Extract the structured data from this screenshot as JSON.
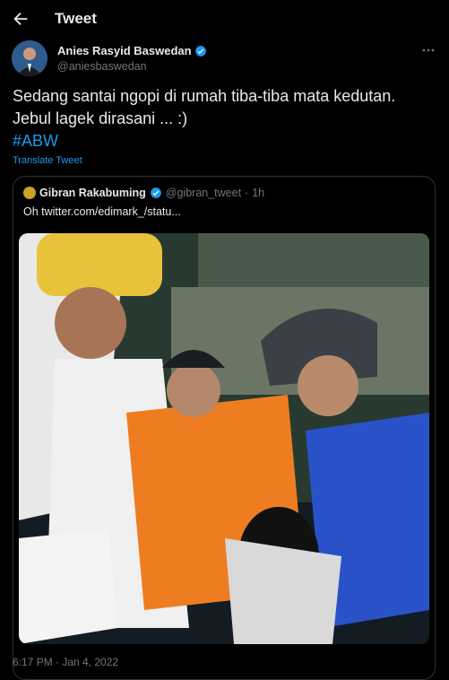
{
  "header": {
    "title": "Tweet"
  },
  "author": {
    "name": "Anies Rasyid Baswedan",
    "handle": "@aniesbaswedan"
  },
  "tweet": {
    "line1": "Sedang santai ngopi di rumah tiba-tiba mata kedutan.",
    "line2": "Jebul lagek dirasani ... :)",
    "hashtag": "#ABW",
    "translate": "Translate Tweet"
  },
  "quote": {
    "name": "Gibran Rakabuming",
    "handle": "@gibran_tweet",
    "sep": "·",
    "time": "1h",
    "text": "Oh  twitter.com/edimark_/statu..."
  },
  "timestamp": "6:17 PM · Jan 4, 2022",
  "colors": {
    "accent": "#1d9bf0",
    "muted": "#71767b",
    "border": "#2f3336"
  }
}
